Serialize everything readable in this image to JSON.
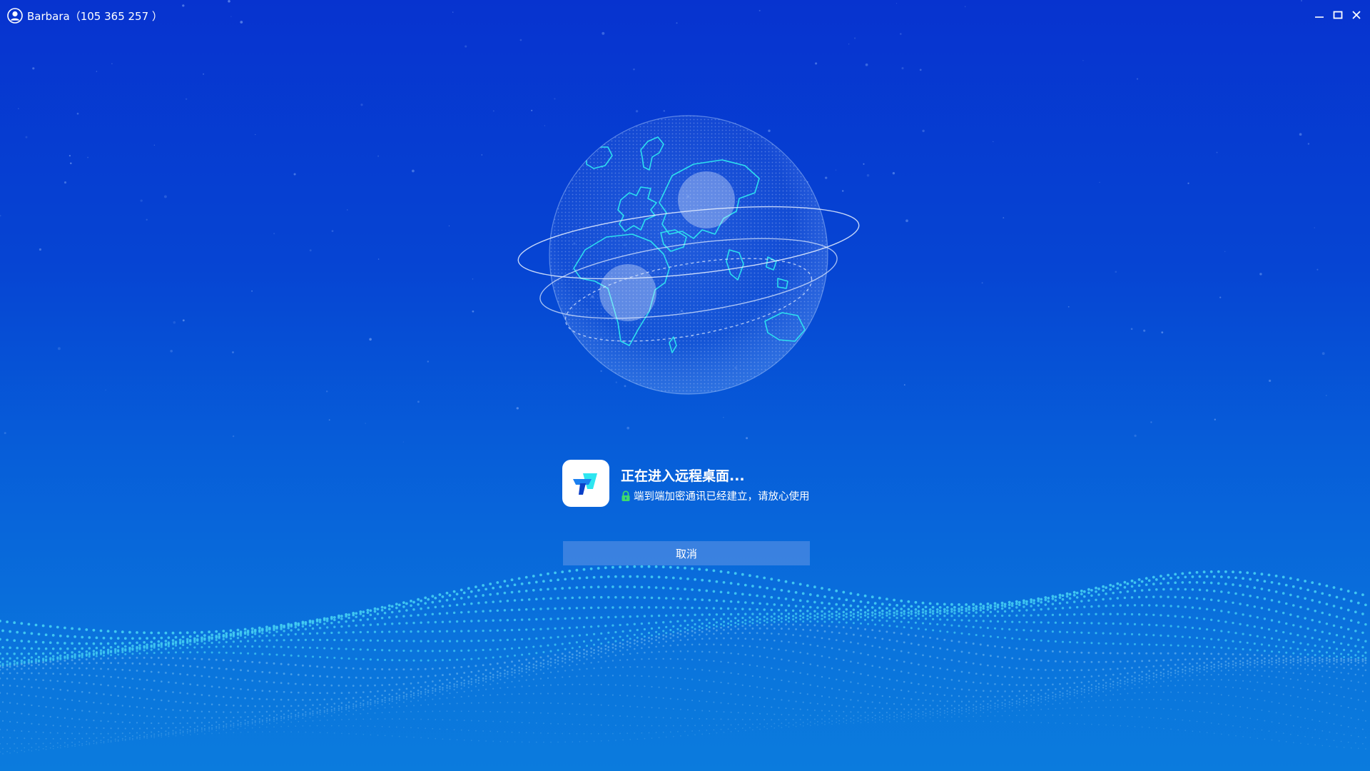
{
  "window": {
    "user_label": "Barbara（105 365 257 ）",
    "icons": {
      "user": "user-icon",
      "minimize": "minimize-icon",
      "maximize": "maximize-icon",
      "close": "close-icon"
    }
  },
  "connection": {
    "title": "正在进入远程桌面...",
    "security_note": "端到端加密通讯已经建立，请放心使用",
    "cancel_label": "取消",
    "icons": {
      "logo": "app-logo-icon",
      "lock": "lock-icon"
    }
  },
  "colors": {
    "background_top": "#0733cf",
    "background_bottom": "#0b7bdd",
    "accent_cyan": "#2ee6f0",
    "lock_green": "#3ddc6b",
    "button_bg": "#5f93e4"
  }
}
